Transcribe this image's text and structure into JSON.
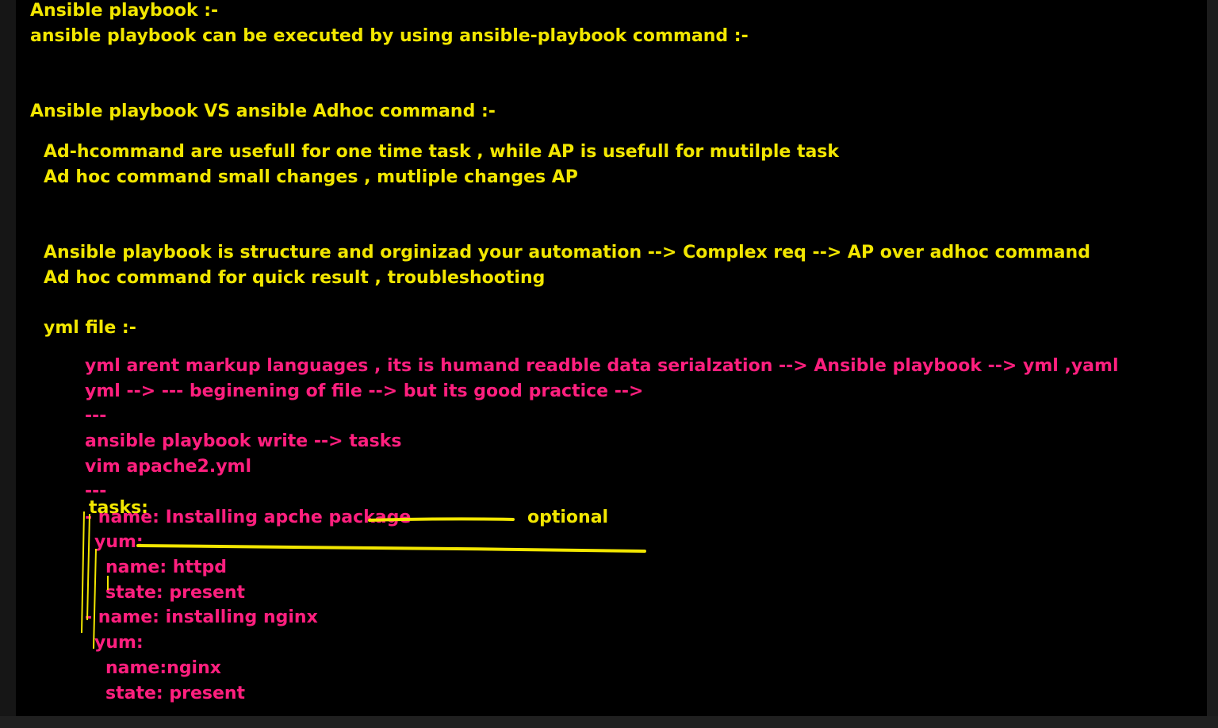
{
  "colors": {
    "yellow_text": "#f2e600",
    "pink_text": "#ff1f7e",
    "background": "#000000",
    "ink_stroke": "#f2e600"
  },
  "notes": {
    "heading1": "Ansible playbook :-",
    "line2": "ansible playbook can be executed by using ansible-playbook command :-",
    "heading2": "Ansible playbook VS ansible Adhoc command :-",
    "compare1": "Ad-hcommand are usefull for one time task , while AP is usefull for mutilple task",
    "compare2": "Ad hoc command small changes , mutliple changes AP",
    "struct1": "Ansible playbook is structure and orginizad your automation --> Complex req --> AP over adhoc command",
    "struct2": "Ad hoc command for quick result , troubleshooting",
    "yml_heading": "yml file :-",
    "yml1": "yml arent markup languages , its is humand readble data serialzation --> Ansible playbook --> yml ,yaml",
    "yml2": "yml --> --- beginening of file --> but its good practice -->",
    "dashes1": "---",
    "yml3": "ansible playbook write --> tasks",
    "yml4": "vim apache2.yml",
    "dashes2": "---",
    "tasks_label": "tasks:",
    "task1_name": "- name: Installing apche package",
    "optional": "optional",
    "task1_yum": "yum:",
    "task1_pkg": "name: httpd",
    "task1_state": "state: present",
    "task2_name": "- name: installing nginx",
    "task2_yum": "yum:",
    "task2_pkg": "name:nginx",
    "task2_state": "state: present"
  }
}
